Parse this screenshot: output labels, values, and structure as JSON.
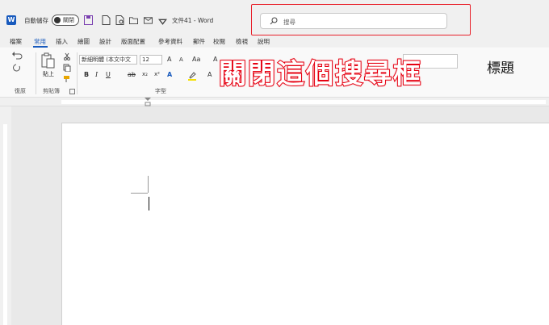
{
  "titlebar": {
    "app_icon": "word-logo-icon",
    "autosave_label": "自動儲存",
    "autosave_toggle": "關閉",
    "document_title": "文件41 - Word",
    "search_placeholder": "搜尋"
  },
  "tabs": [
    "檔案",
    "常用",
    "插入",
    "繪圖",
    "設計",
    "版面配置",
    "參考資料",
    "郵件",
    "校閱",
    "檢視",
    "說明"
  ],
  "active_tab": "常用",
  "ribbon": {
    "undo_group": "復原",
    "clipboard_group": "剪貼簿",
    "paste_label": "貼上",
    "font_group": "字型",
    "font_name": "新細明體 (本文中文",
    "font_size": "12",
    "style_heading": "標題"
  },
  "annotation": "關閉這個搜尋框",
  "colors": {
    "accent": "#185abd",
    "highlight_red": "#e60012"
  }
}
